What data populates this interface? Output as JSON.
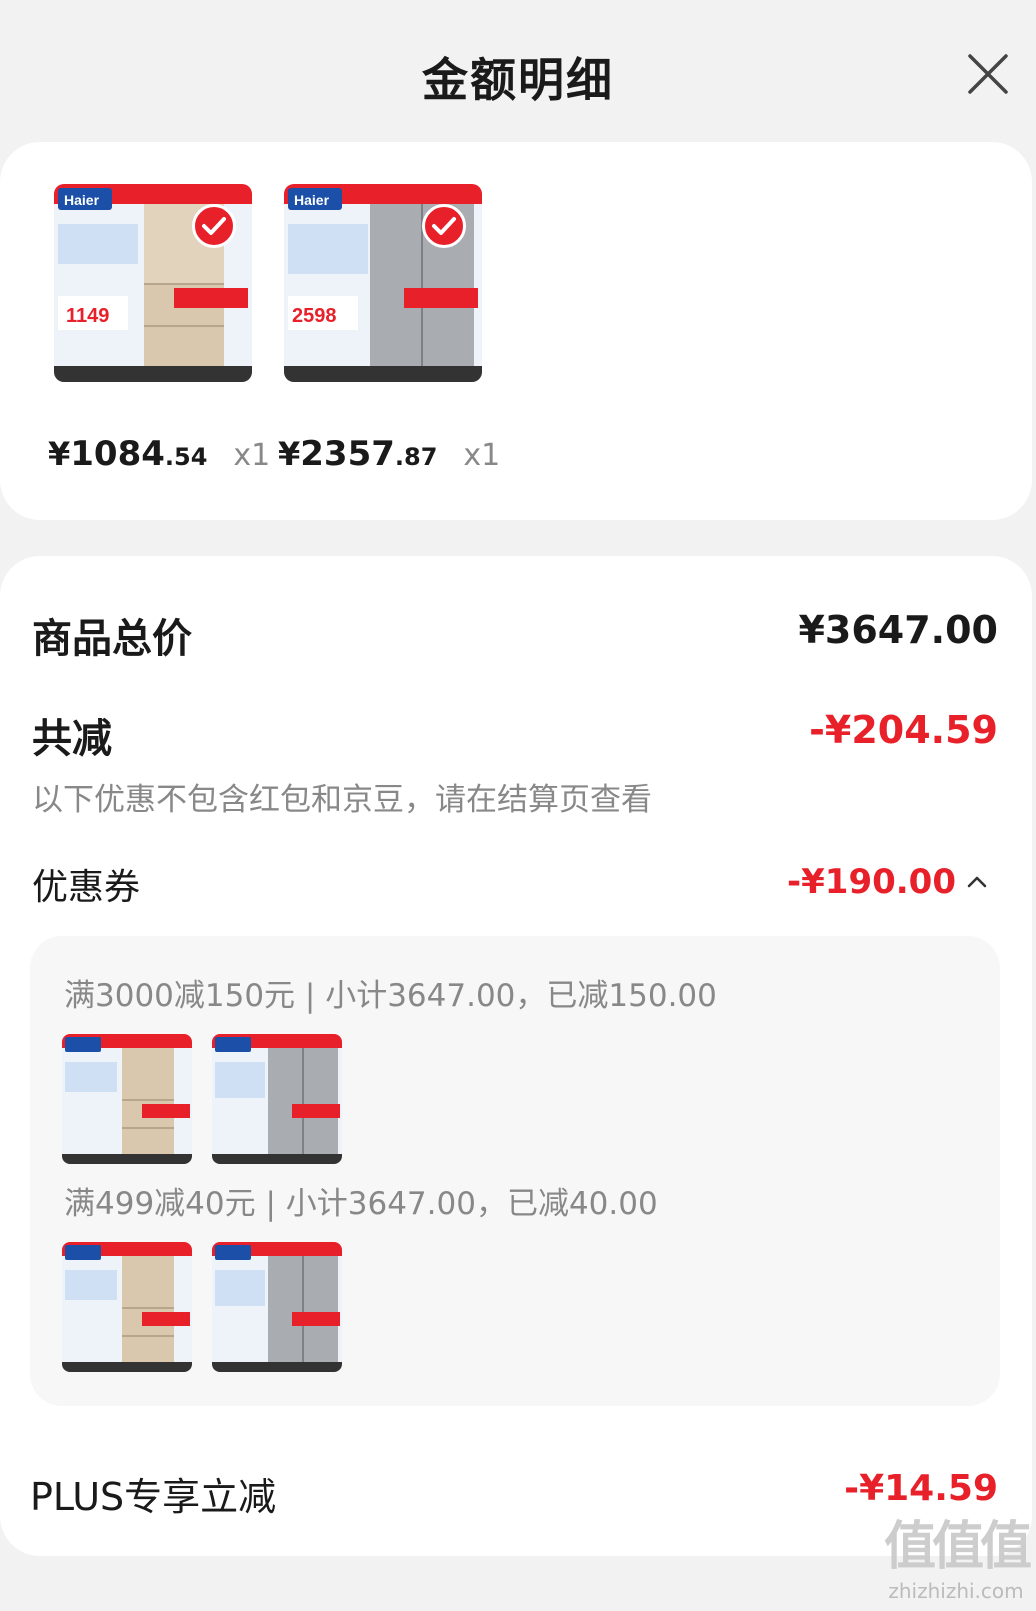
{
  "header": {
    "title": "金额明细"
  },
  "products": [
    {
      "price_yen": "¥",
      "price_int": "1084",
      "price_dec": ".54",
      "qty": "x1",
      "image": "fridge-three-door-gold",
      "promo_price": "1149"
    },
    {
      "price_yen": "¥",
      "price_int": "2357",
      "price_dec": ".87",
      "qty": "x1",
      "image": "fridge-side-by-side-silver",
      "promo_price": "2598"
    }
  ],
  "summary": {
    "total_label": "商品总价",
    "total_value": "¥3647.00",
    "discount_label": "共减",
    "discount_value": "-¥204.59",
    "note": "以下优惠不包含红包和京豆，请在结算页查看"
  },
  "coupon": {
    "label": "优惠券",
    "value": "-¥190.00",
    "rules": [
      {
        "text": "满3000减150元 | 小计3647.00，已减150.00"
      },
      {
        "text": "满499减40元 | 小计3647.00，已减40.00"
      }
    ]
  },
  "plus": {
    "label": "PLUS专享立减",
    "value": "-¥14.59"
  },
  "watermark": {
    "glyphs": "值值值",
    "url": "zhizhizhi.com"
  },
  "colors": {
    "accent": "#e8202a",
    "muted": "#888888",
    "panel": "#f7f7f7"
  }
}
